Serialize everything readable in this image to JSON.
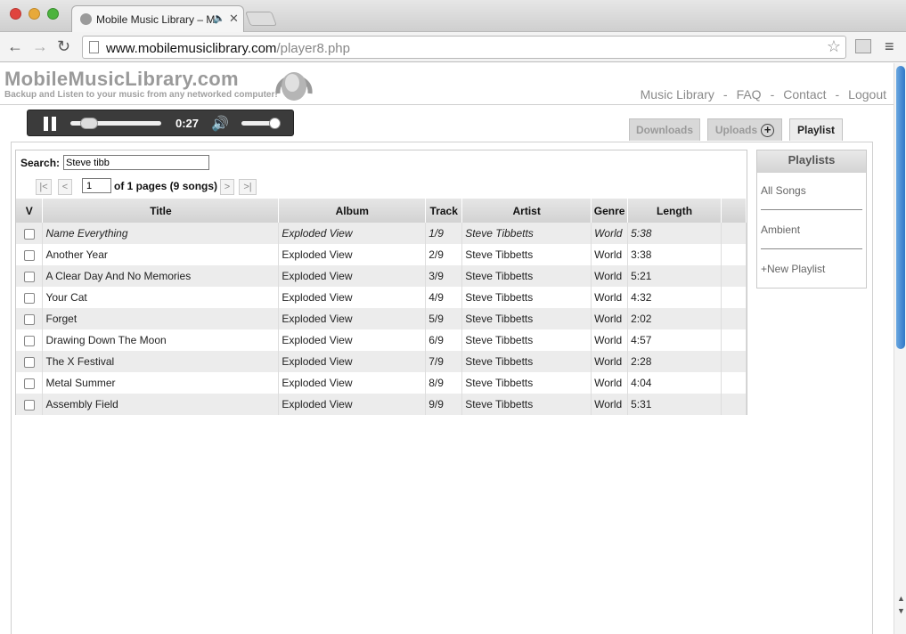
{
  "browser": {
    "tab_title": "Mobile Music Library – M",
    "tab_close": "✕",
    "url_host": "www.mobilemusiclibrary.com",
    "url_path": "/player8.php",
    "back": "←",
    "forward": "→",
    "reload": "↻",
    "star": "☆",
    "menu": "≡",
    "speaker": "🔈"
  },
  "header": {
    "logo_title": "MobileMusicLibrary.com",
    "logo_subtitle": "Backup and Listen to your music from any networked computer!",
    "nav": [
      "Music Library",
      "FAQ",
      "Contact",
      "Logout"
    ],
    "nav_separator": "-"
  },
  "player": {
    "time": "0:27",
    "volume_icon": "🔊",
    "progress": 0.15,
    "volume": 0.85
  },
  "tabs": {
    "downloads": "Downloads",
    "uploads": "Uploads",
    "uploads_plus": "+",
    "playlist": "Playlist"
  },
  "search": {
    "label": "Search:",
    "value": "Steve tibb"
  },
  "pagination": {
    "first": "|<",
    "prev": "<",
    "page": "1",
    "summary": "of 1 pages (9 songs)",
    "next": ">",
    "last": ">|"
  },
  "table": {
    "headers": [
      "V",
      "Title",
      "Album",
      "Track",
      "Artist",
      "Genre",
      "Length"
    ],
    "rows": [
      {
        "title": "Name Everything",
        "album": "Exploded View",
        "track": "1/9",
        "artist": "Steve Tibbetts",
        "genre": "World",
        "length": "5:38"
      },
      {
        "title": "Another Year",
        "album": "Exploded View",
        "track": "2/9",
        "artist": "Steve Tibbetts",
        "genre": "World",
        "length": "3:38"
      },
      {
        "title": "A Clear Day And No Memories",
        "album": "Exploded View",
        "track": "3/9",
        "artist": "Steve Tibbetts",
        "genre": "World",
        "length": "5:21"
      },
      {
        "title": "Your Cat",
        "album": "Exploded View",
        "track": "4/9",
        "artist": "Steve Tibbetts",
        "genre": "World",
        "length": "4:32"
      },
      {
        "title": "Forget",
        "album": "Exploded View",
        "track": "5/9",
        "artist": "Steve Tibbetts",
        "genre": "World",
        "length": "2:02"
      },
      {
        "title": "Drawing Down The Moon",
        "album": "Exploded View",
        "track": "6/9",
        "artist": "Steve Tibbetts",
        "genre": "World",
        "length": "4:57"
      },
      {
        "title": "The X Festival",
        "album": "Exploded View",
        "track": "7/9",
        "artist": "Steve Tibbetts",
        "genre": "World",
        "length": "2:28"
      },
      {
        "title": "Metal Summer",
        "album": "Exploded View",
        "track": "8/9",
        "artist": "Steve Tibbetts",
        "genre": "World",
        "length": "4:04"
      },
      {
        "title": "Assembly Field",
        "album": "Exploded View",
        "track": "9/9",
        "artist": "Steve Tibbetts",
        "genre": "World",
        "length": "5:31"
      }
    ]
  },
  "playlists": {
    "header": "Playlists",
    "items": [
      "All Songs",
      "Ambient"
    ],
    "new_playlist": "+New Playlist"
  },
  "scrollbar": {
    "up": "▲",
    "down": "▼"
  }
}
